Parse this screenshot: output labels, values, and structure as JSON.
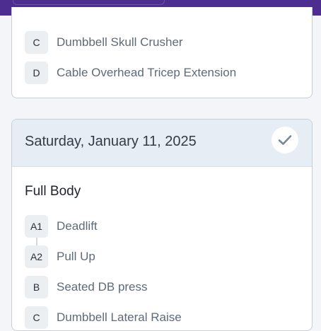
{
  "previous_card": {
    "exercises": [
      {
        "label": "C",
        "name": "Dumbbell Skull Crusher"
      },
      {
        "label": "D",
        "name": "Cable Overhead Tricep Extension"
      }
    ]
  },
  "saturday_card": {
    "date": "Saturday, January 11, 2025",
    "completed": true,
    "workout_title": "Full Body",
    "exercises": [
      {
        "label": "A1",
        "name": "Deadlift"
      },
      {
        "label": "A2",
        "name": "Pull Up"
      },
      {
        "label": "B",
        "name": "Seated DB press"
      },
      {
        "label": "C",
        "name": "Dumbbell Lateral Raise"
      }
    ]
  },
  "colors": {
    "header_bar": "#4e2d91",
    "card_header": "#e7edf4",
    "check": "#7b8796"
  },
  "icons": {
    "complete": "checkmark-icon"
  }
}
